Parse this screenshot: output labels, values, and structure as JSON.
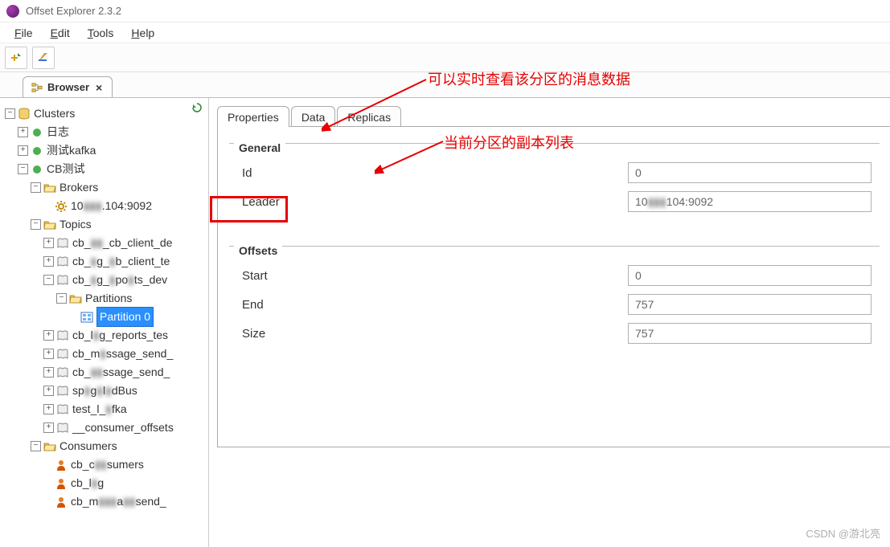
{
  "window": {
    "title": "Offset Explorer  2.3.2"
  },
  "menubar": {
    "file": "File",
    "edit": "Edit",
    "tools": "Tools",
    "help": "Help"
  },
  "toolbar_buttons": {
    "b1": "add",
    "b2": "edit"
  },
  "browser_tab": {
    "label": "Browser",
    "close": "×"
  },
  "tree": {
    "root": "Clusters",
    "c1": "日志",
    "c2": "测试kafka",
    "c3": "CB测试",
    "brokers": "Brokers",
    "broker1_a": "10",
    "broker1_b": ".104:9092",
    "topics": "Topics",
    "t1a": "cb_",
    "t1b": "_cb_client_de",
    "t2a": "cb_",
    "t2b": "g_",
    "t2c": "b_client_te",
    "t3a": "cb_",
    "t3b": "g_",
    "t3c": "po",
    "t3d": "ts_dev",
    "partitions": "Partitions",
    "partition0": "Partition 0",
    "t4a": "cb_l",
    "t4b": "g_reports_tes",
    "t5a": "cb_m",
    "t5b": "ssage_send_",
    "t6a": "cb_",
    "t6b": "ssage_send_",
    "t7a": "sp",
    "t7b": "g",
    "t7c": "l",
    "t7d": "dBus",
    "t8a": "test_l_",
    "t8b": "fka",
    "t9": "__consumer_offsets",
    "consumers": "Consumers",
    "cs1a": "cb_c",
    "cs1b": "sumers",
    "cs2a": "cb_l",
    "cs2b": "g",
    "cs3a": "cb_m",
    "cs3b": "a",
    "cs3c": "send_"
  },
  "tabs": {
    "properties": "Properties",
    "data": "Data",
    "replicas": "Replicas"
  },
  "general": {
    "title": "General",
    "id_label": "Id",
    "id_value": "0",
    "leader_label": "Leader",
    "leader_value_a": "10",
    "leader_value_b": "104:9092"
  },
  "offsets": {
    "title": "Offsets",
    "start_label": "Start",
    "start_value": "0",
    "end_label": "End",
    "end_value": "757",
    "size_label": "Size",
    "size_value": "757"
  },
  "annotations": {
    "a1": "可以实时查看该分区的消息数据",
    "a2": "当前分区的副本列表"
  },
  "watermark": "CSDN @游北亮"
}
